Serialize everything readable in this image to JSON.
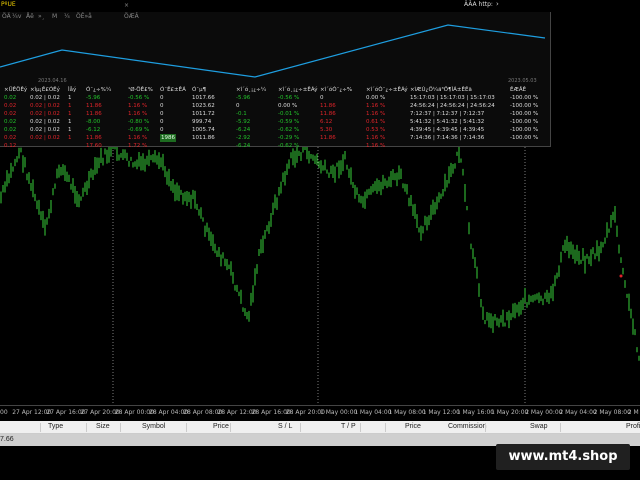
{
  "overlay": {
    "title": "PºUE",
    "close_glyph": "×",
    "link_text": "ÂÂA http:",
    "link_arrow": "›",
    "tabs": [
      {
        "label": "ÖÄ"
      },
      {
        "label": "¼v"
      },
      {
        "label": "Åê"
      },
      {
        "label": "»¸"
      },
      {
        "label": "M"
      },
      {
        "label": "¼"
      },
      {
        "label": "ÖÊ»å"
      },
      {
        "label": "ÖÆÂ"
      }
    ],
    "date_left": "2023.04.16",
    "date_right": "2023.05.03",
    "line_color": "#1e9ee0"
  },
  "table": {
    "headers": [
      "×ÜÊÖÊý",
      "×îµ¡Ê£ÓÊý",
      "Ìåý",
      "Ó¯¿÷%¼",
      "¹Ø·ÖÊ£%",
      "Ó¯Ê£±ÊÁ",
      "Ó¯µ¶",
      "×î´ó¸¡¿÷¼",
      "×î´ó¸¡¿÷±ÊÁý",
      "×î´óÓ¯¿÷%",
      "×î´óÓ¯¿÷±ÊÁý",
      "×îÆÚ¿Ö¼ä³Ö¶ÌÁ±ÊÊä",
      "ÊÆÂÊ"
    ],
    "rows": [
      {
        "c": [
          "0.02",
          "0.02 | 0.02",
          "1",
          "-5.96",
          "-0.56 %",
          "0",
          "1017.66",
          "-5.96",
          "-0.56 %",
          "0",
          "0.00 %",
          "15:17:03 | 15:17:03 | 15:17:03",
          "-100.00 %"
        ],
        "tone": [
          "green",
          "white",
          "white",
          "green",
          "green",
          "white",
          "white",
          "green",
          "green",
          "white",
          "white",
          "white",
          "white"
        ]
      },
      {
        "c": [
          "0.02",
          "0.02 | 0.02",
          "1",
          "11.86",
          "1.16 %",
          "0",
          "1023.62",
          "0",
          "0.00 %",
          "11.86",
          "1.16 %",
          "24:56:24 | 24:56:24 | 24:56:24",
          "-100.00 %"
        ],
        "tone": [
          "red",
          "red",
          "red",
          "red",
          "red",
          "white",
          "white",
          "white",
          "white",
          "red",
          "red",
          "white",
          "white"
        ]
      },
      {
        "c": [
          "0.02",
          "0.02 | 0.02",
          "1",
          "11.86",
          "1.16 %",
          "0",
          "1011.72",
          "-0.1",
          "-0.01 %",
          "11.86",
          "1.16 %",
          "7:12:37 | 7:12:37 | 7:12:37",
          "-100.00 %"
        ],
        "tone": [
          "red",
          "red",
          "red",
          "red",
          "red",
          "white",
          "white",
          "green",
          "green",
          "red",
          "red",
          "white",
          "white"
        ]
      },
      {
        "c": [
          "0.02",
          "0.02 | 0.02",
          "1",
          "-8.00",
          "-0.80 %",
          "0",
          "999.74",
          "-5.92",
          "-0.59 %",
          "6.12",
          "0.61 %",
          "5:41:32 | 5:41:32 | 5:41:32",
          "-100.00 %"
        ],
        "tone": [
          "green",
          "white",
          "white",
          "green",
          "green",
          "white",
          "white",
          "green",
          "green",
          "red",
          "red",
          "white",
          "white"
        ]
      },
      {
        "c": [
          "0.02",
          "0.02 | 0.02",
          "1",
          "-6.12",
          "-0.69 %",
          "0",
          "1005.74",
          "-6.24",
          "-0.62 %",
          "5.30",
          "0.53 %",
          "4:39:45 | 4:39:45 | 4:39:45",
          "-100.00 %"
        ],
        "tone": [
          "green",
          "white",
          "white",
          "green",
          "green",
          "white",
          "white",
          "green",
          "green",
          "red",
          "red",
          "white",
          "white"
        ]
      },
      {
        "c": [
          "0.02",
          "0.02 | 0.02",
          "1",
          "11.86",
          "1.16 %",
          "1986",
          "1011.86",
          "-2.92",
          "-0.29 %",
          "11.86",
          "1.16 %",
          "7:14:36 | 7:14:36 | 7:14:36",
          "-100.00 %"
        ],
        "tone": [
          "red",
          "red",
          "red",
          "red",
          "red",
          "red",
          "white",
          "green",
          "green",
          "red",
          "red",
          "white",
          "white"
        ]
      },
      {
        "c": [
          "0.12",
          "",
          "",
          "17.60",
          "1.72 %",
          "",
          "",
          "-6.24",
          "-0.62 %",
          "",
          "1.16 %",
          "",
          ""
        ],
        "tone": [
          "red",
          "white",
          "white",
          "red",
          "red",
          "white",
          "white",
          "green",
          "green",
          "white",
          "red",
          "white",
          "white"
        ]
      }
    ]
  },
  "time_axis": {
    "labels": [
      "00",
      "27 Apr 12:00",
      "27 Apr 16:00",
      "27 Apr 20:00",
      "28 Apr 00:00",
      "28 Apr 04:00",
      "28 Apr 08:00",
      "28 Apr 12:00",
      "28 Apr 16:00",
      "28 Apr 20:00",
      "1 May 00:00",
      "1 May 04:00",
      "1 May 08:00",
      "1 May 12:00",
      "1 May 16:00",
      "1 May 20:00",
      "2 May 00:00",
      "2 May 04:00",
      "2 May 08:00",
      "2 M"
    ]
  },
  "terminal": {
    "columns": [
      "Type",
      "Size",
      "Symbol",
      "Price",
      "S / L",
      "T / P",
      "Price",
      "Commission",
      "Swap",
      "Profi"
    ],
    "balance_value": "7.66"
  },
  "watermark": {
    "text": "www.mt4.shop"
  },
  "colors": {
    "candle": "#39d13a",
    "background": "#000000",
    "overlay_line": "#1e9ee0",
    "profit_green": "#22c22a",
    "loss_red": "#e0242a"
  }
}
